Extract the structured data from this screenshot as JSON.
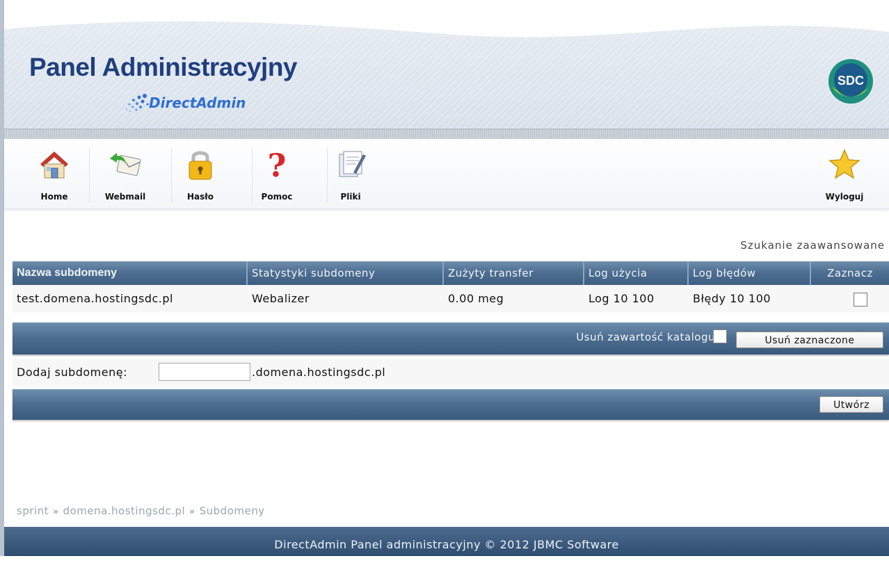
{
  "header": {
    "title": "Panel Administracyjny",
    "subtitle": "DirectAdmin",
    "logo_text": "SDC"
  },
  "toolbar": {
    "items": [
      {
        "label": "Home",
        "icon": "home-icon"
      },
      {
        "label": "Webmail",
        "icon": "mail-icon"
      },
      {
        "label": "Hasło",
        "icon": "lock-icon"
      },
      {
        "label": "Pomoc",
        "icon": "help-icon"
      },
      {
        "label": "Pliki",
        "icon": "files-icon"
      }
    ],
    "logout": {
      "label": "Wyloguj",
      "icon": "star-icon"
    }
  },
  "advanced_search": "Szukanie zaawansowane",
  "table": {
    "columns": [
      "Nazwa subdomeny",
      "Statystyki subdomeny",
      "Zużyty transfer",
      "Log użycia",
      "Log błędów",
      "Zaznacz"
    ],
    "rows": [
      {
        "name": "test.domena.hostingsdc.pl",
        "stats": "Webalizer",
        "transfer": "0.00 meg",
        "usage_log": "Log 10 100",
        "error_log": "Błędy 10 100",
        "selected": false
      }
    ]
  },
  "delete_bar": {
    "remove_contents_label": "Usuń zawartość katalogu",
    "delete_selected_button": "Usuń zaznaczone"
  },
  "add_form": {
    "label": "Dodaj subdomenę:",
    "value": "",
    "suffix": ".domena.hostingsdc.pl",
    "create_button": "Utwórz"
  },
  "breadcrumb": [
    "sprint",
    "domena.hostingsdc.pl",
    "Subdomeny"
  ],
  "footer": "DirectAdmin Panel administracyjny © 2012 JBMC Software"
}
